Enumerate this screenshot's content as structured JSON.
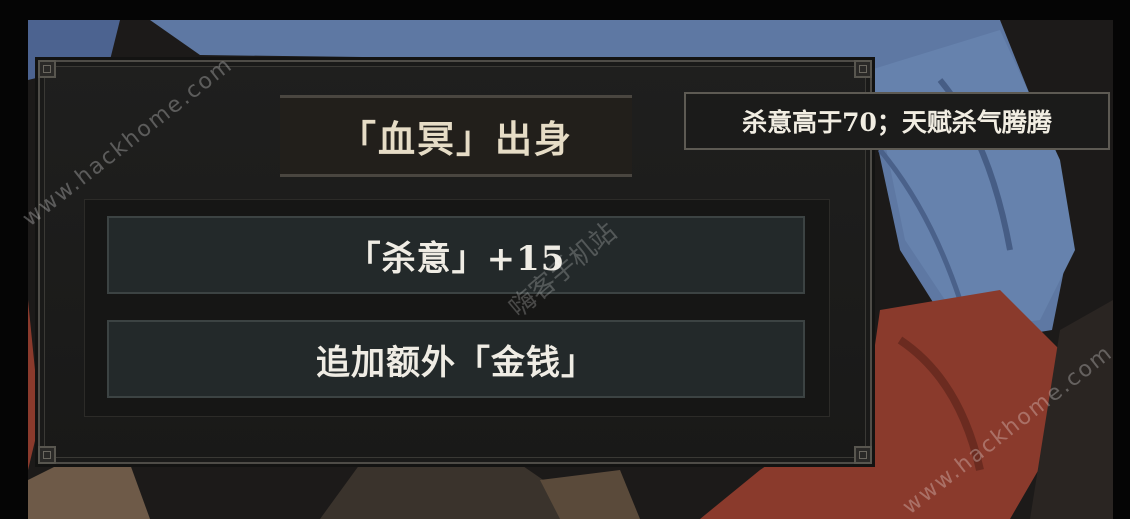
{
  "dialog": {
    "title": "「血冥」出身",
    "options": [
      {
        "label": "「杀意」+15"
      },
      {
        "label": "追加额外「金钱」"
      }
    ]
  },
  "tooltip": {
    "text": "杀意高于70；天赋杀气腾腾"
  },
  "watermarks": {
    "url_1": "www.hackhome.com",
    "url_2": "www.hackhome.com",
    "cn": "嗨客手机站"
  },
  "colors": {
    "panel": "#1f1f1e",
    "button": "#23292a",
    "text": "#efece4",
    "cloth_blue": "#5e78a3",
    "cloth_red": "#8a3a2c"
  }
}
